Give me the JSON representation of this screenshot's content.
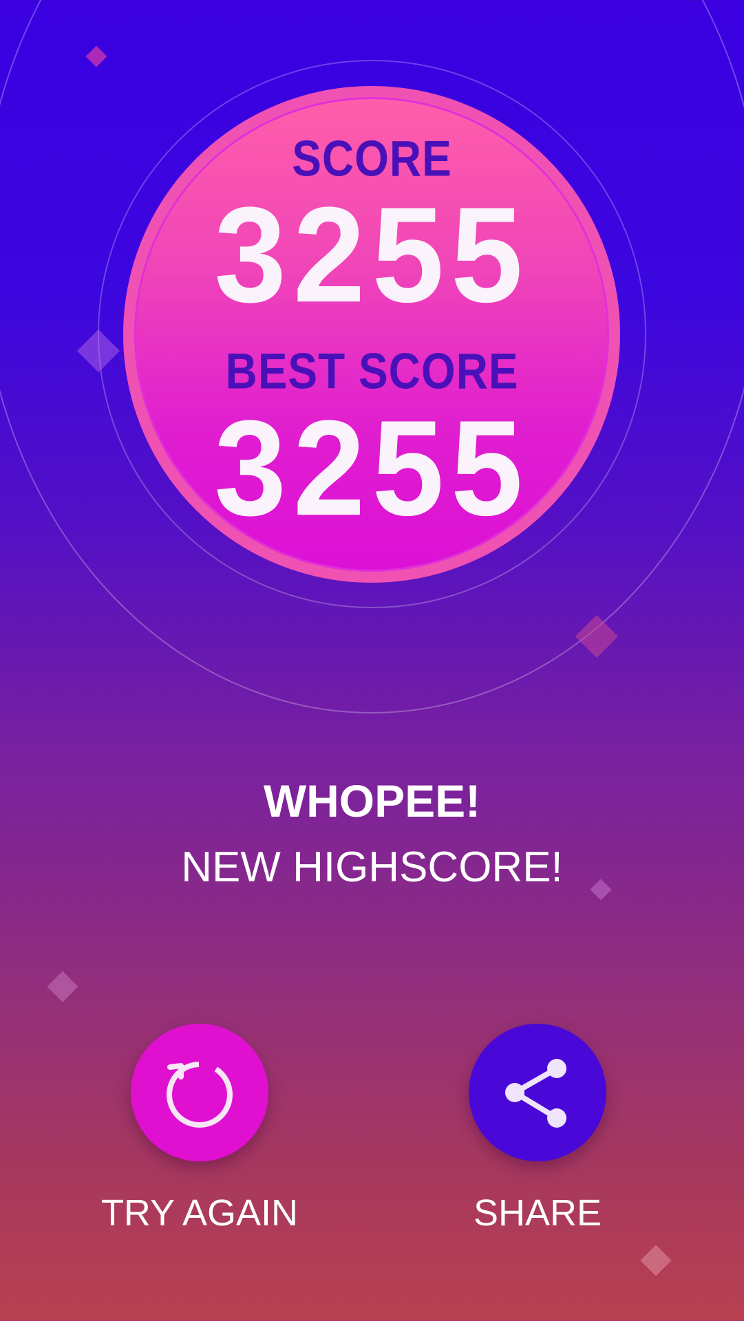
{
  "score": {
    "label": "SCORE",
    "value": "3255"
  },
  "best": {
    "label": "BEST SCORE",
    "value": "3255"
  },
  "message": {
    "title": "WHOPEE!",
    "subtitle": "NEW HIGHSCORE!"
  },
  "buttons": {
    "try_again": {
      "label": "TRY AGAIN",
      "icon": "restart-icon",
      "color": "#e010d0"
    },
    "share": {
      "label": "SHARE",
      "icon": "share-icon",
      "color": "#4a08d8"
    }
  },
  "colors": {
    "background_top": "#3a00e0",
    "background_bottom": "#b84050",
    "disc_top": "#ff5eaa",
    "disc_bottom": "#dc10d6",
    "label_color": "#4a10b8"
  }
}
